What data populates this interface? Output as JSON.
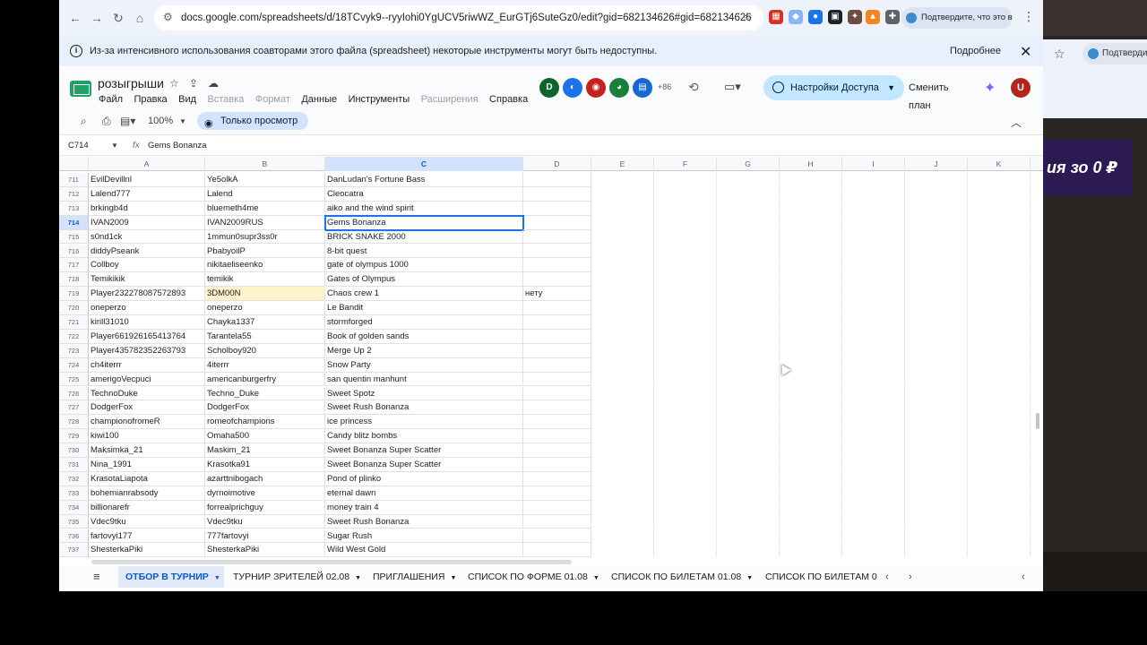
{
  "browser": {
    "url": "docs.google.com/spreadsheets/d/18TCvyk9--ryyIohi0YgUCV5riwWZ_EurGTj6SuteGz0/edit?gid=682134626#gid=682134626",
    "verify_pill": "Подтвердите, что это вы",
    "bg_window_pill": "Подтверди",
    "bg_banner": "ия зо 0 ₽"
  },
  "infobar": {
    "message": "Из-за интенсивного использования соавторами этого файла (spreadsheet) некоторые инструменты могут быть недоступны.",
    "more": "Подробнее"
  },
  "doc": {
    "title": "розыгрыши",
    "menu": [
      "Файл",
      "Правка",
      "Вид",
      "Вставка",
      "Формат",
      "Данные",
      "Инструменты",
      "Расширения",
      "Справка"
    ],
    "menu_dim": [
      false,
      false,
      false,
      true,
      true,
      false,
      false,
      true,
      false
    ],
    "collaborators_extra": "+86",
    "share_label": "Настройки Доступа",
    "upgrade_label": "Сменить план",
    "user_initial": "U",
    "avatar_initial_1": "D"
  },
  "toolbar": {
    "zoom": "100%",
    "view_only": "Только просмотр"
  },
  "formula_bar": {
    "cell_ref": "C714",
    "value": "Gems Bonanza"
  },
  "grid": {
    "columns": [
      "A",
      "B",
      "C",
      "D",
      "E",
      "F",
      "G",
      "H",
      "I",
      "J",
      "K"
    ],
    "selected_column": "C",
    "active_row": "714",
    "rows": [
      {
        "n": "711",
        "a": "EvilDevillnl",
        "b": "Ye5olkA",
        "c": "DanLudan's Fortune Bass",
        "d": ""
      },
      {
        "n": "712",
        "a": "Lalend777",
        "b": "Lalend",
        "c": "Cleocatra",
        "d": ""
      },
      {
        "n": "713",
        "a": "brkingb4d",
        "b": "bluemeth4me",
        "c": "aiko and the wind spirit",
        "d": ""
      },
      {
        "n": "714",
        "a": "IVAN2009",
        "b": "IVAN2009RUS",
        "c": "Gems Bonanza",
        "d": ""
      },
      {
        "n": "715",
        "a": "s0nd1ck",
        "b": "1mmun0supr3ss0r",
        "c": "BRICK SNAKE 2000",
        "d": ""
      },
      {
        "n": "716",
        "a": "diddyPseank",
        "b": "PbabyoilP",
        "c": "8-bit quest",
        "d": ""
      },
      {
        "n": "717",
        "a": "Collboy",
        "b": "nikitaeliseenko",
        "c": "gate of olympus 1000",
        "d": ""
      },
      {
        "n": "718",
        "a": "Temikikik",
        "b": "temikik",
        "c": "Gates of Olympus",
        "d": ""
      },
      {
        "n": "719",
        "a": "Player232278087572893",
        "b": "3DM00N",
        "c": "Chaos crew 1",
        "d": "нету"
      },
      {
        "n": "720",
        "a": "oneperzo",
        "b": "oneperzo",
        "c": "Le Bandit",
        "d": ""
      },
      {
        "n": "721",
        "a": "kirill31010",
        "b": "Chayka1337",
        "c": "stormforged",
        "d": ""
      },
      {
        "n": "722",
        "a": "Player661926165413764",
        "b": "Tarantela55",
        "c": "Book of golden sands",
        "d": ""
      },
      {
        "n": "723",
        "a": "Player435782352263793",
        "b": " Scholboy920",
        "c": "Merge Up 2",
        "d": ""
      },
      {
        "n": "724",
        "a": "ch4iterrr",
        "b": "4iterrr",
        "c": "Snow Party",
        "d": ""
      },
      {
        "n": "725",
        "a": "amerigoVecpuci",
        "b": "americanburgerfry",
        "c": "san quentin manhunt",
        "d": ""
      },
      {
        "n": "726",
        "a": "TechnoDuke",
        "b": "Techno_Duke",
        "c": "Sweet Spotz",
        "d": ""
      },
      {
        "n": "727",
        "a": "DodgerFox",
        "b": "DodgerFox",
        "c": "Sweet Rush Bonanza",
        "d": ""
      },
      {
        "n": "728",
        "a": "championofromeR",
        "b": "romeofchampions",
        "c": "ice princess",
        "d": ""
      },
      {
        "n": "729",
        "a": "kiwi100",
        "b": "Omaha500",
        "c": "Candy blitz bombs",
        "d": ""
      },
      {
        "n": "730",
        "a": "Maksimka_21",
        "b": "Maskim_21",
        "c": "Sweet Bonanza Super Scatter",
        "d": ""
      },
      {
        "n": "731",
        "a": "Nina_1991",
        "b": "Krasotka91",
        "c": "Sweet Bonanza Super Scatter",
        "d": ""
      },
      {
        "n": "732",
        "a": "KrasotaLiapota",
        "b": "azarttnibogach",
        "c": "Pond of plinko",
        "d": ""
      },
      {
        "n": "733",
        "a": "bohemianrabsody",
        "b": "dyrnoimotive",
        "c": "eternal dawn",
        "d": ""
      },
      {
        "n": "734",
        "a": "billionarefr",
        "b": "forrealprichguy",
        "c": "money train 4",
        "d": ""
      },
      {
        "n": "735",
        "a": "Vdec9tku",
        "b": "Vdec9tku",
        "c": "Sweet Rush Bonanza",
        "d": ""
      },
      {
        "n": "736",
        "a": "fartovyi177",
        "b": "777fartovyi",
        "c": "Sugar Rush",
        "d": ""
      },
      {
        "n": "737",
        "a": "ShesterkaPiki",
        "b": "ShesterkaPiki",
        "c": "Wild West Gold",
        "d": ""
      }
    ]
  },
  "sheet_tabs": [
    {
      "label": "ОТБОР В ТУРНИР",
      "active": true
    },
    {
      "label": "ТУРНИР ЗРИТЕЛЕЙ 02.08",
      "active": false
    },
    {
      "label": "ПРИГЛАШЕНИЯ",
      "active": false
    },
    {
      "label": "СПИСОК ПО ФОРМЕ 01.08",
      "active": false
    },
    {
      "label": "СПИСОК ПО БИЛЕТАМ 01.08",
      "active": false
    },
    {
      "label": "СПИСОК ПО БИЛЕТАМ 0",
      "active": false
    }
  ],
  "colors": {
    "accent": "#0b57d0",
    "share_bg": "#c2e7ff",
    "highlight_yellow": "#fff2cc",
    "sheets_green": "#1ea362"
  }
}
